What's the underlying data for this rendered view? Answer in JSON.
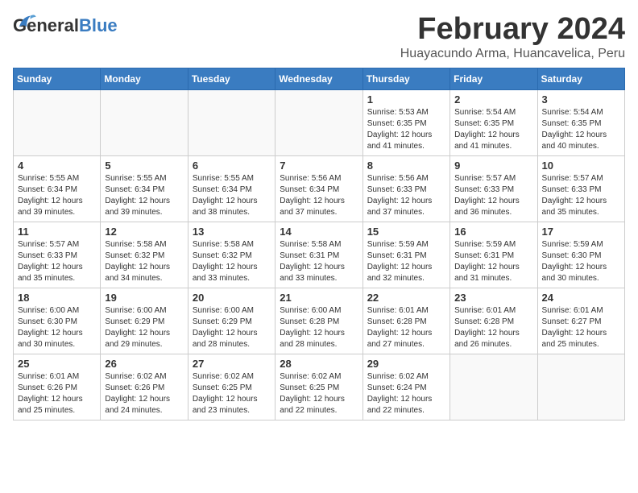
{
  "logo": {
    "general": "General",
    "blue": "Blue"
  },
  "header": {
    "title": "February 2024",
    "subtitle": "Huayacundo Arma, Huancavelica, Peru"
  },
  "days_of_week": [
    "Sunday",
    "Monday",
    "Tuesday",
    "Wednesday",
    "Thursday",
    "Friday",
    "Saturday"
  ],
  "weeks": [
    [
      {
        "day": "",
        "info": ""
      },
      {
        "day": "",
        "info": ""
      },
      {
        "day": "",
        "info": ""
      },
      {
        "day": "",
        "info": ""
      },
      {
        "day": "1",
        "info": "Sunrise: 5:53 AM\nSunset: 6:35 PM\nDaylight: 12 hours\nand 41 minutes."
      },
      {
        "day": "2",
        "info": "Sunrise: 5:54 AM\nSunset: 6:35 PM\nDaylight: 12 hours\nand 41 minutes."
      },
      {
        "day": "3",
        "info": "Sunrise: 5:54 AM\nSunset: 6:35 PM\nDaylight: 12 hours\nand 40 minutes."
      }
    ],
    [
      {
        "day": "4",
        "info": "Sunrise: 5:55 AM\nSunset: 6:34 PM\nDaylight: 12 hours\nand 39 minutes."
      },
      {
        "day": "5",
        "info": "Sunrise: 5:55 AM\nSunset: 6:34 PM\nDaylight: 12 hours\nand 39 minutes."
      },
      {
        "day": "6",
        "info": "Sunrise: 5:55 AM\nSunset: 6:34 PM\nDaylight: 12 hours\nand 38 minutes."
      },
      {
        "day": "7",
        "info": "Sunrise: 5:56 AM\nSunset: 6:34 PM\nDaylight: 12 hours\nand 37 minutes."
      },
      {
        "day": "8",
        "info": "Sunrise: 5:56 AM\nSunset: 6:33 PM\nDaylight: 12 hours\nand 37 minutes."
      },
      {
        "day": "9",
        "info": "Sunrise: 5:57 AM\nSunset: 6:33 PM\nDaylight: 12 hours\nand 36 minutes."
      },
      {
        "day": "10",
        "info": "Sunrise: 5:57 AM\nSunset: 6:33 PM\nDaylight: 12 hours\nand 35 minutes."
      }
    ],
    [
      {
        "day": "11",
        "info": "Sunrise: 5:57 AM\nSunset: 6:33 PM\nDaylight: 12 hours\nand 35 minutes."
      },
      {
        "day": "12",
        "info": "Sunrise: 5:58 AM\nSunset: 6:32 PM\nDaylight: 12 hours\nand 34 minutes."
      },
      {
        "day": "13",
        "info": "Sunrise: 5:58 AM\nSunset: 6:32 PM\nDaylight: 12 hours\nand 33 minutes."
      },
      {
        "day": "14",
        "info": "Sunrise: 5:58 AM\nSunset: 6:31 PM\nDaylight: 12 hours\nand 33 minutes."
      },
      {
        "day": "15",
        "info": "Sunrise: 5:59 AM\nSunset: 6:31 PM\nDaylight: 12 hours\nand 32 minutes."
      },
      {
        "day": "16",
        "info": "Sunrise: 5:59 AM\nSunset: 6:31 PM\nDaylight: 12 hours\nand 31 minutes."
      },
      {
        "day": "17",
        "info": "Sunrise: 5:59 AM\nSunset: 6:30 PM\nDaylight: 12 hours\nand 30 minutes."
      }
    ],
    [
      {
        "day": "18",
        "info": "Sunrise: 6:00 AM\nSunset: 6:30 PM\nDaylight: 12 hours\nand 30 minutes."
      },
      {
        "day": "19",
        "info": "Sunrise: 6:00 AM\nSunset: 6:29 PM\nDaylight: 12 hours\nand 29 minutes."
      },
      {
        "day": "20",
        "info": "Sunrise: 6:00 AM\nSunset: 6:29 PM\nDaylight: 12 hours\nand 28 minutes."
      },
      {
        "day": "21",
        "info": "Sunrise: 6:00 AM\nSunset: 6:28 PM\nDaylight: 12 hours\nand 28 minutes."
      },
      {
        "day": "22",
        "info": "Sunrise: 6:01 AM\nSunset: 6:28 PM\nDaylight: 12 hours\nand 27 minutes."
      },
      {
        "day": "23",
        "info": "Sunrise: 6:01 AM\nSunset: 6:28 PM\nDaylight: 12 hours\nand 26 minutes."
      },
      {
        "day": "24",
        "info": "Sunrise: 6:01 AM\nSunset: 6:27 PM\nDaylight: 12 hours\nand 25 minutes."
      }
    ],
    [
      {
        "day": "25",
        "info": "Sunrise: 6:01 AM\nSunset: 6:26 PM\nDaylight: 12 hours\nand 25 minutes."
      },
      {
        "day": "26",
        "info": "Sunrise: 6:02 AM\nSunset: 6:26 PM\nDaylight: 12 hours\nand 24 minutes."
      },
      {
        "day": "27",
        "info": "Sunrise: 6:02 AM\nSunset: 6:25 PM\nDaylight: 12 hours\nand 23 minutes."
      },
      {
        "day": "28",
        "info": "Sunrise: 6:02 AM\nSunset: 6:25 PM\nDaylight: 12 hours\nand 22 minutes."
      },
      {
        "day": "29",
        "info": "Sunrise: 6:02 AM\nSunset: 6:24 PM\nDaylight: 12 hours\nand 22 minutes."
      },
      {
        "day": "",
        "info": ""
      },
      {
        "day": "",
        "info": ""
      }
    ]
  ]
}
